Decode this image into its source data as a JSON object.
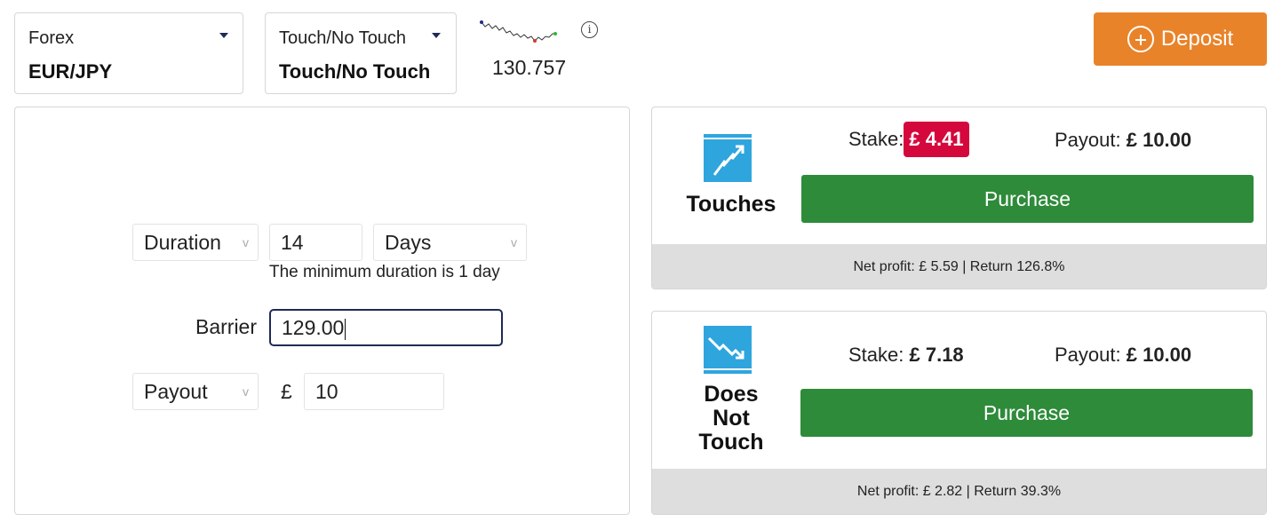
{
  "market": {
    "category": "Forex",
    "symbol": "EUR/JPY"
  },
  "contract_type": {
    "category": "Touch/No Touch",
    "value": "Touch/No Touch"
  },
  "spot_price": "130.757",
  "deposit_label": "Deposit",
  "form": {
    "duration_label": "Duration",
    "duration_value": "14",
    "duration_unit": "Days",
    "duration_hint": "The minimum duration is 1 day",
    "barrier_label": "Barrier",
    "barrier_value": "129.00",
    "payout_label": "Payout",
    "currency_symbol": "£",
    "payout_value": "10"
  },
  "contracts": [
    {
      "name": "Touches",
      "stake_label": "Stake:",
      "stake_value": "£ 4.41",
      "payout_label": "Payout:",
      "payout_value": "£ 10.00",
      "purchase_label": "Purchase",
      "footer": "Net profit: £ 5.59 | Return 126.8%"
    },
    {
      "name_lines": [
        "Does",
        "Not",
        "Touch"
      ],
      "stake_label": "Stake:",
      "stake_value": "£ 7.18",
      "payout_label": "Payout:",
      "payout_value": "£ 10.00",
      "purchase_label": "Purchase",
      "footer": "Net profit: £ 2.82 | Return 39.3%"
    }
  ],
  "colors": {
    "deposit": "#e9832a",
    "purchase": "#2e8b3a",
    "stake_badge": "#d4083c",
    "icon_bg": "#2fa5de"
  },
  "icons": [
    "caret-down-icon",
    "sparkline-icon",
    "info-icon",
    "plus-circle-icon",
    "chevron-down-icon",
    "touch-up-icon",
    "no-touch-down-icon"
  ]
}
